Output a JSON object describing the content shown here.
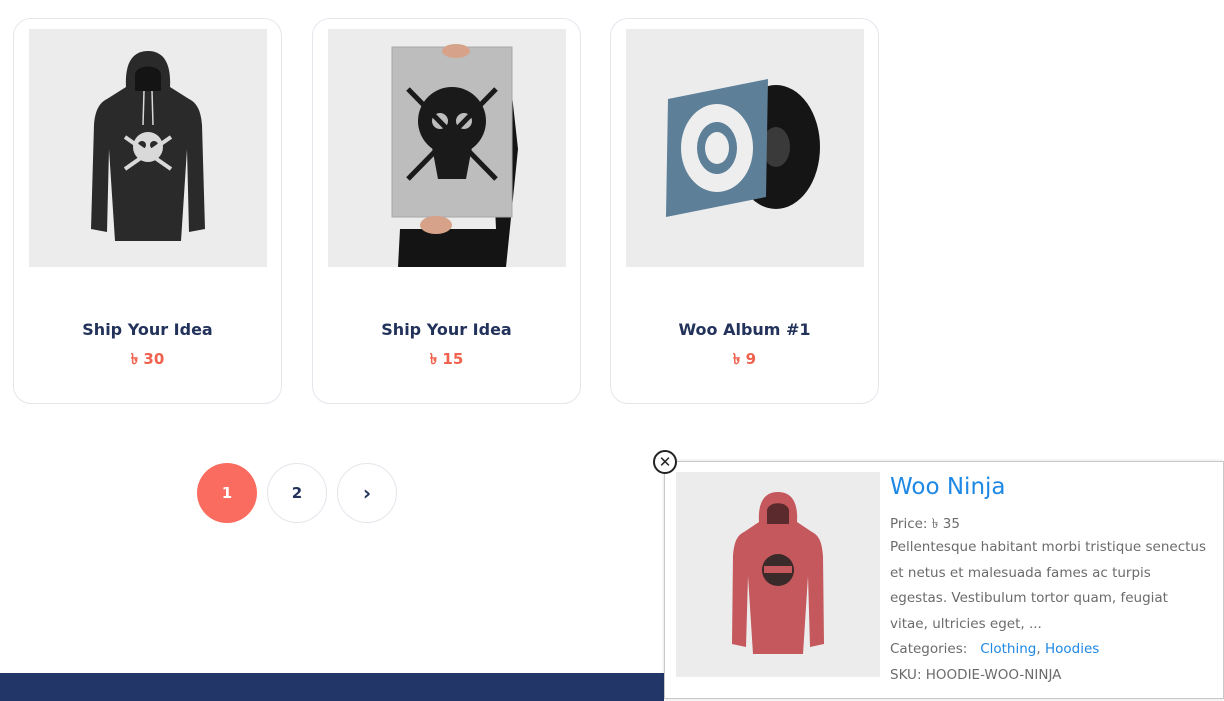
{
  "products": [
    {
      "title": "Ship Your Idea",
      "price": "৳ 30",
      "image": "black-hoodie-skull-image"
    },
    {
      "title": "Ship Your Idea",
      "price": "৳ 15",
      "image": "poster-skull-image"
    },
    {
      "title": "Woo Album #1",
      "price": "৳ 9",
      "image": "vinyl-album-image"
    }
  ],
  "pagination": {
    "pages": [
      "1",
      "2"
    ],
    "active": "1",
    "next_icon": "chevron-right-icon",
    "next_label": "›"
  },
  "popup": {
    "close_icon": "close-icon",
    "close_label": "✕",
    "title": "Woo Ninja",
    "price_line": "Price: ৳ 35",
    "description": "Pellentesque habitant morbi tristique senectus et netus et malesuada fames ac turpis egestas. Vestibulum tortor quam, feugiat vitae, ultricies eget, ...",
    "categories_label": "Categories:",
    "categories": [
      "Clothing",
      "Hoodies"
    ],
    "categories_sep": ", ",
    "sku_line": "SKU: HOODIE-WOO-NINJA",
    "image": "pink-hoodie-ninja-image"
  },
  "colors": {
    "accent": "#fa6c5f",
    "price": "#f0624d",
    "link": "#1e88e5",
    "footer": "#223768",
    "title": "#22325a"
  }
}
